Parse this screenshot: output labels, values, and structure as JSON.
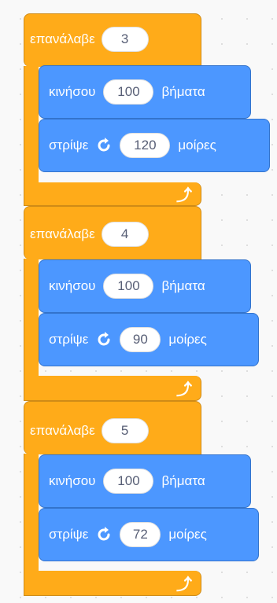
{
  "loops": [
    {
      "label": "επανάλαβε",
      "count": "3",
      "move": {
        "label": "κινήσου",
        "value": "100",
        "unit": "βήματα"
      },
      "turn": {
        "label": "στρίψε",
        "value": "120",
        "unit": "μοίρες"
      }
    },
    {
      "label": "επανάλαβε",
      "count": "4",
      "move": {
        "label": "κινήσου",
        "value": "100",
        "unit": "βήματα"
      },
      "turn": {
        "label": "στρίψε",
        "value": "90",
        "unit": "μοίρες"
      }
    },
    {
      "label": "επανάλαβε",
      "count": "5",
      "move": {
        "label": "κινήσου",
        "value": "100",
        "unit": "βήματα"
      },
      "turn": {
        "label": "στρίψε",
        "value": "72",
        "unit": "μοίρες"
      }
    }
  ],
  "icons": {
    "turn": "rotate-counterclockwise-icon",
    "loop_end": "loop-arrow-icon"
  },
  "colors": {
    "control": "#ffab19",
    "motion": "#4c97ff",
    "input_text": "#575e75"
  }
}
